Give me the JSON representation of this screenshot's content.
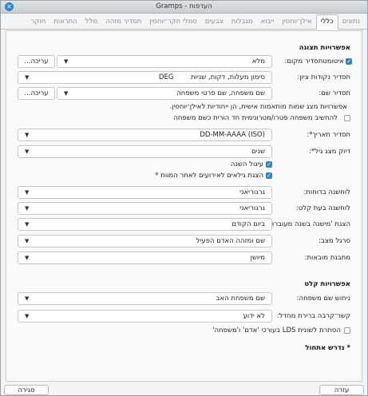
{
  "window": {
    "title": "Gramps - העדפות"
  },
  "tabs": [
    "נתונים",
    "כללי",
    "אילן־יוחסין",
    "ייבוא",
    "מגבלות",
    "צבעים",
    "סמלי חקר־יוחסין",
    "תסדיר מזהה",
    "מלל",
    "התראות",
    "חוקר"
  ],
  "display": {
    "heading": "אפשרויות תצוגה",
    "place_format": {
      "label": "תסדיר מקום:",
      "auto_label": "איטומט",
      "value": "מלא",
      "edit": "עריכה..."
    },
    "coord_format": {
      "label": "תסדיר נקודות ציון:",
      "value": "סימון מעלות, דקות, שניות        DEG"
    },
    "name_format": {
      "label": "תסדיר שם:",
      "value": "שם משפחה, שם פרטי משפחה",
      "edit": "עריכה..."
    },
    "name_note": "אפשרויות מצג שמות מותאמות אישית, הן ייחודיות לאילן־יוחסין.",
    "surname_guess": "להחשיב משפחה פטרו/מטרונימית חד הורית כשם משפחה",
    "date_format": {
      "label": "תסדיר תאריך*:",
      "value": "DD-MM-AAAA (ISO)"
    },
    "age_precision": {
      "label": "דיוק מצג גיל*:",
      "value": "שנים"
    },
    "round_year": "עיגול השנה",
    "show_age_after_death": "הצגת גילאים לאירועים לאחר המוות *",
    "calendar_reports": {
      "label": "לוחשנה בדוחות:",
      "value": "גרגוריאני"
    },
    "calendar_input": {
      "label": "לוחשנה בעת קלט:",
      "value": "גרגוריאני"
    },
    "new_year": {
      "label": "הצגת 'מישנה בשנה מעוברת:",
      "value": "ביום הקודם"
    },
    "status_bar": {
      "label": "סרגל מצב:",
      "value": "שם ומזהה האדם הפעיל"
    },
    "import_format": {
      "label": "מתבנת מובאות:",
      "value": "מיושן"
    }
  },
  "input": {
    "heading": "אפשרויות קלט",
    "surname_guessing": {
      "label": "ניחוש שם משפחה:",
      "value": "שם משפחת האב"
    },
    "family_relation": {
      "label": "קשר־קרבה ברירת מחדל:",
      "value": "לא ידוע"
    },
    "hide_lds": "הסתרת לשונית LDS בעורכי 'אדם' ו'משפחה'"
  },
  "restart_note": "* נדרש אתחול",
  "footer": {
    "help": "עזרה",
    "close": "סגירה"
  },
  "colors": {
    "accent": "#2f86c8"
  }
}
